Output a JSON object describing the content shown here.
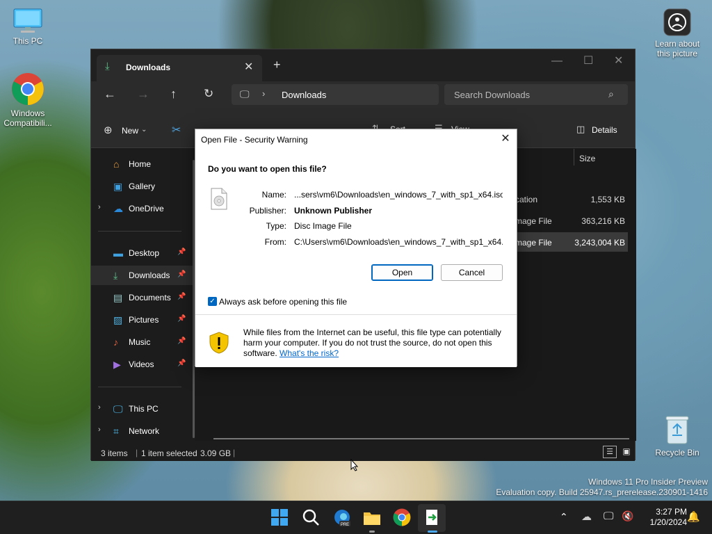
{
  "desktop": {
    "icons": [
      {
        "label": "This PC"
      },
      {
        "label": "Windows Compatibili..."
      },
      {
        "label": "Learn about this picture"
      },
      {
        "label": "Recycle Bin"
      }
    ],
    "watermark_line1": "Windows 11 Pro Insider Preview",
    "watermark_line2": "Evaluation copy. Build 25947.rs_prerelease.230901-1416"
  },
  "explorer": {
    "tab_title": "Downloads",
    "breadcrumb": "Downloads",
    "search_placeholder": "Search Downloads",
    "toolbar": {
      "new_label": "New",
      "sort_label": "Sort",
      "view_label": "View",
      "details_label": "Details"
    },
    "column_size_header": "Size",
    "rows": [
      {
        "type_fragment": "cation",
        "size": "1,553 KB",
        "selected": false
      },
      {
        "type_fragment": "mage File",
        "size": "363,216 KB",
        "selected": false
      },
      {
        "type_fragment": "mage File",
        "size": "3,243,004 KB",
        "selected": true
      }
    ],
    "nav": {
      "home": "Home",
      "gallery": "Gallery",
      "onedrive": "OneDrive",
      "desktop": "Desktop",
      "downloads": "Downloads",
      "documents": "Documents",
      "pictures": "Pictures",
      "music": "Music",
      "videos": "Videos",
      "thispc": "This PC",
      "network": "Network"
    },
    "status": {
      "items": "3 items",
      "selected": "1 item selected",
      "selected_size": "3.09 GB"
    }
  },
  "dialog": {
    "title": "Open File - Security Warning",
    "question": "Do you want to open this file?",
    "labels": {
      "name": "Name:",
      "publisher": "Publisher:",
      "type": "Type:",
      "from": "From:"
    },
    "values": {
      "name": "...sers\\vm6\\Downloads\\en_windows_7_with_sp1_x64.iso",
      "publisher": "Unknown Publisher",
      "type": "Disc Image File",
      "from": "C:\\Users\\vm6\\Downloads\\en_windows_7_with_sp1_x64..."
    },
    "open_button": "Open",
    "cancel_button": "Cancel",
    "checkbox_label": "Always ask before opening this file",
    "checkbox_checked": true,
    "warning_text": "While files from the Internet can be useful, this file type can potentially harm your computer. If you do not trust the source, do not open this software.",
    "risk_link": "What's the risk?"
  },
  "taskbar": {
    "time": "3:27 PM",
    "date": "1/20/2024",
    "accent": "#0078d4"
  }
}
